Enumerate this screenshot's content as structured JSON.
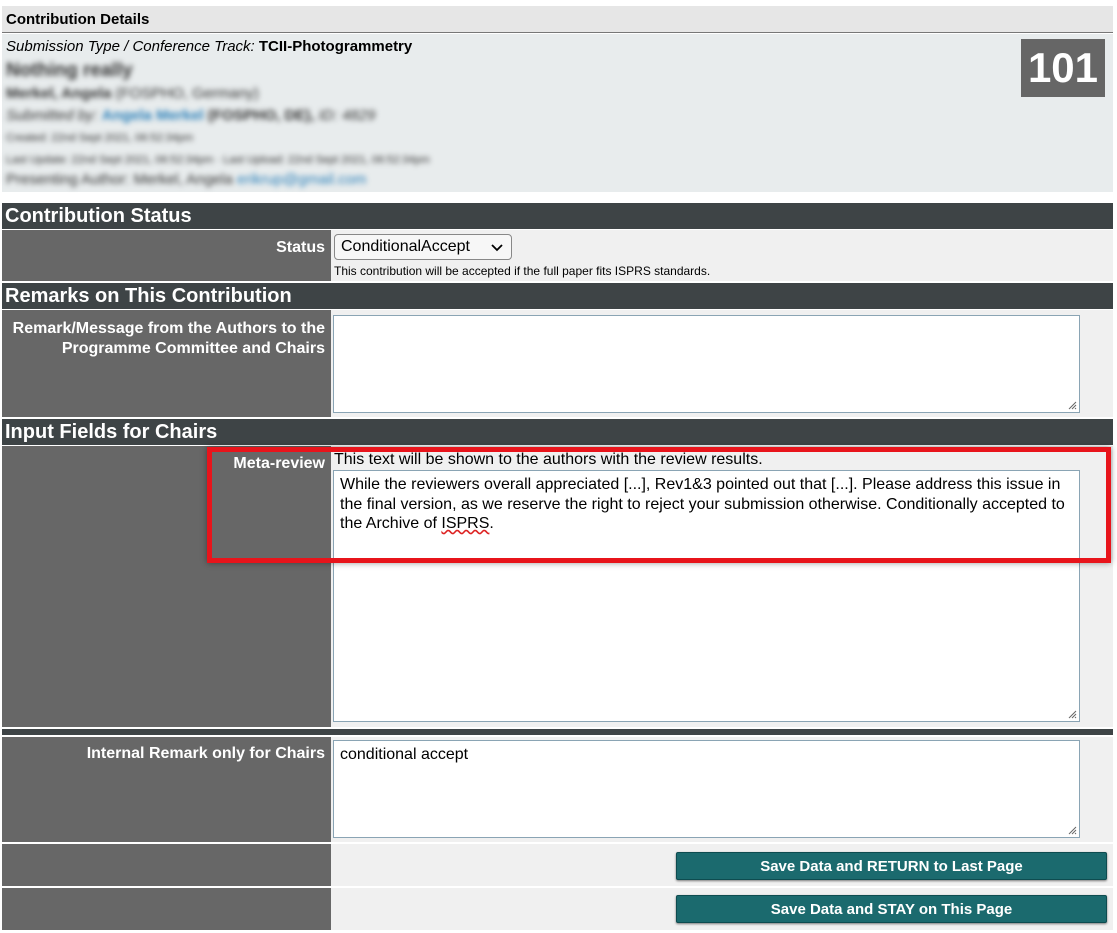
{
  "contribution_details": {
    "title": "Contribution Details",
    "type_label": "Submission Type / Conference Track:",
    "type_value": "TCII-Photogrammetry",
    "contribution_title": "Nothing really",
    "author_name": "Merkel, Angela",
    "author_affil": "(FOSPHO, Germany)",
    "submitted_by_label": "Submitted by:",
    "submitted_by_name": "Angela Merkel",
    "submitted_by_affil": "(FOSPHO, DE),",
    "submitted_by_id": "ID: 4829",
    "created": "Created: 22nd Sept 2021, 06:52:34pm",
    "last_update": "Last Update: 22nd Sept 2021, 06:52:34pm · Last Upload: 22nd Sept 2021, 06:52:34pm",
    "presenting_label": "Presenting Author: Merkel, Angela",
    "presenting_email": "erikrup@gmail.com",
    "number": "101"
  },
  "contribution_status": {
    "header": "Contribution Status",
    "status_label": "Status",
    "status_value": "ConditionalAccept",
    "status_note": "This contribution will be accepted if the full paper fits ISPRS standards."
  },
  "remarks": {
    "header": "Remarks on This Contribution",
    "label": "Remark/Message from the Authors to the Programme Committee and Chairs",
    "value": ""
  },
  "chairs": {
    "header": "Input Fields for Chairs",
    "meta_review_label": "Meta-review",
    "meta_review_hint": "This text will be shown to the authors with the review results.",
    "meta_review_text_a": "While the reviewers overall appreciated [...], Rev1&3 pointed out that [...]. Please address this issue in the final version, as we reserve the right to reject your submission otherwise.  Conditionally accepted to the Archive of ",
    "meta_review_text_b": "ISPRS",
    "meta_review_text_c": ".",
    "internal_label": "Internal Remark only for Chairs",
    "internal_value": "conditional accept"
  },
  "actions": {
    "save_return": "Save Data and RETURN to Last Page",
    "save_stay": "Save Data and STAY on This Page"
  },
  "icons": {
    "status_dropdown": "chevron-down-icon",
    "resize": "resize-grip-icon"
  },
  "colors": {
    "section_header": "#3e4446",
    "label_cell": "#676767",
    "button": "#1b6a6e",
    "highlight": "#e8141b"
  }
}
